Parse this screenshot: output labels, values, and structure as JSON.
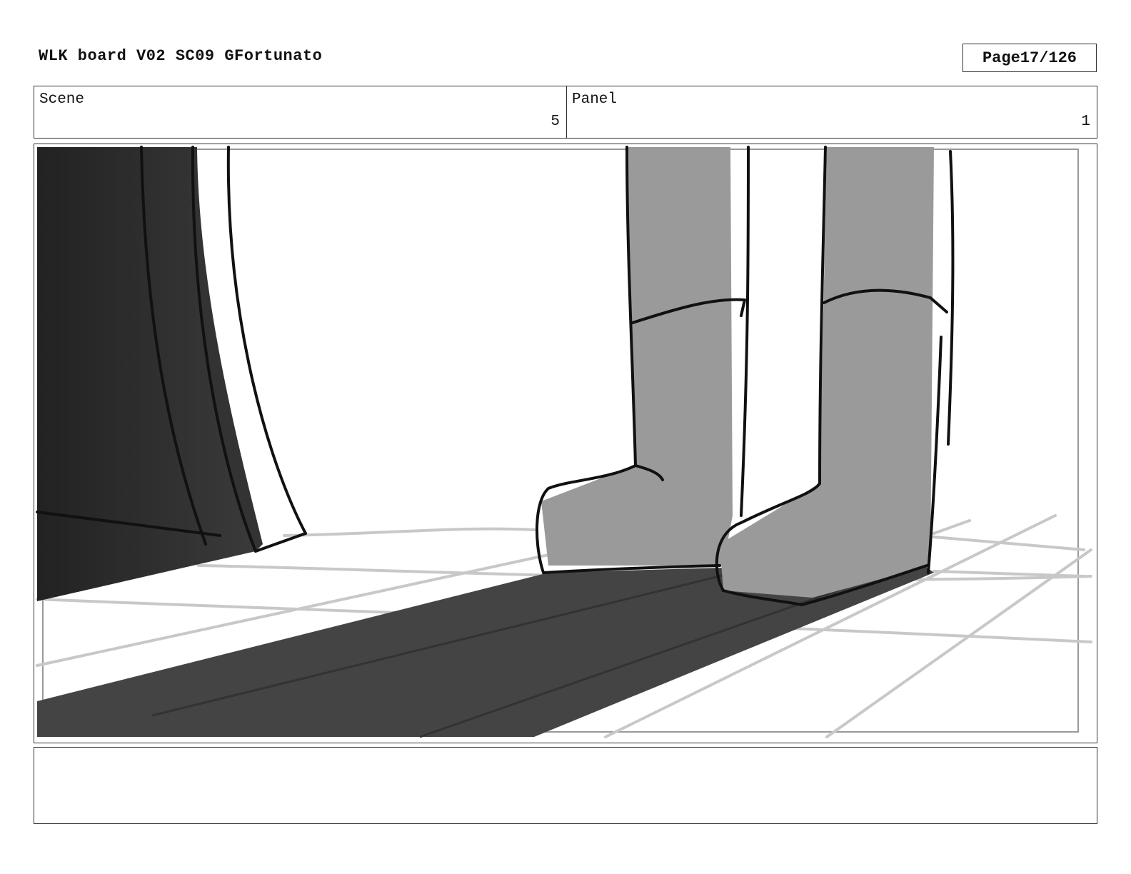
{
  "header": {
    "title": "WLK board V02 SC09 GFortunato",
    "page_label": "Page",
    "page_number": "17/126"
  },
  "info": {
    "scene_label": "Scene",
    "scene_value": "5",
    "panel_label": "Panel",
    "panel_value": "1"
  },
  "notes": {
    "text": ""
  },
  "colors": {
    "border": "#333333",
    "dark_shadow": "#444444",
    "dark_column": "#2b2b2b",
    "boot_gray": "#9a9a9a",
    "floor_line": "#c8c8c8",
    "ink": "#111111"
  },
  "panel_drawing": {
    "description_icon": "storyboard-sketch-icon"
  }
}
